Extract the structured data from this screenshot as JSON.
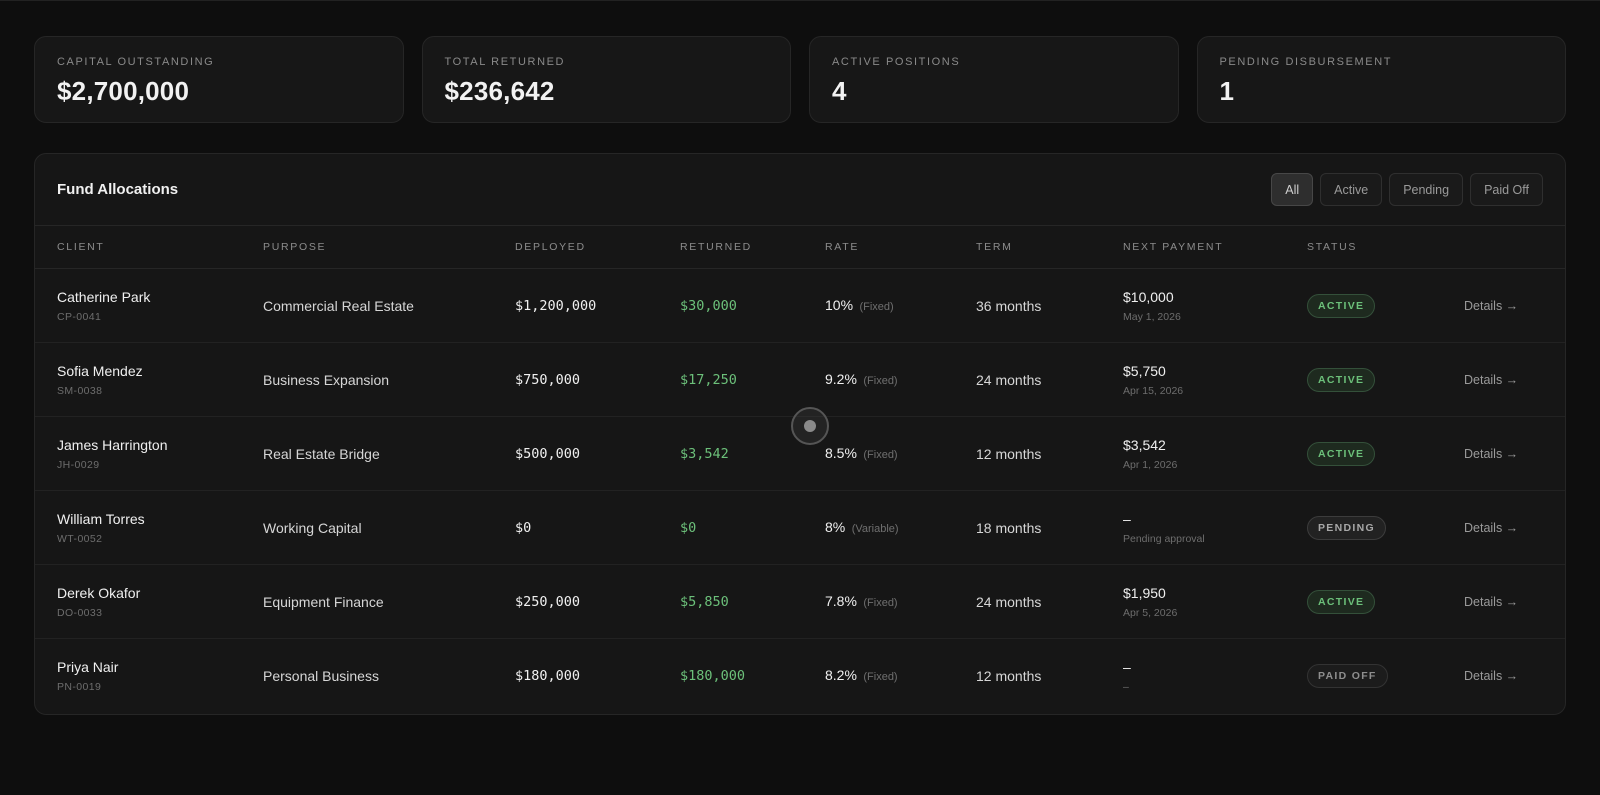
{
  "stats": [
    {
      "label": "Capital Outstanding",
      "value": "$2,700,000"
    },
    {
      "label": "Total Returned",
      "value": "$236,642"
    },
    {
      "label": "Active Positions",
      "value": "4"
    },
    {
      "label": "Pending Disbursement",
      "value": "1"
    }
  ],
  "panel": {
    "title": "Fund Allocations",
    "filters": [
      "All",
      "Active",
      "Pending",
      "Paid Off"
    ],
    "active_filter": "All"
  },
  "table": {
    "headers": [
      "Client",
      "Purpose",
      "Deployed",
      "Returned",
      "Rate",
      "Term",
      "Next Payment",
      "Status"
    ],
    "rows": [
      {
        "name": "Catherine Park",
        "id": "CP-0041",
        "purpose": "Commercial Real Estate",
        "deployed": "$1,200,000",
        "returned": "$30,000",
        "rate": "10%",
        "rate_type": "(Fixed)",
        "term": "36 months",
        "next_amount": "$10,000",
        "next_date": "May 1, 2026",
        "status": "Active",
        "action": "Details →"
      },
      {
        "name": "Sofia Mendez",
        "id": "SM-0038",
        "purpose": "Business Expansion",
        "deployed": "$750,000",
        "returned": "$17,250",
        "rate": "9.2%",
        "rate_type": "(Fixed)",
        "term": "24 months",
        "next_amount": "$5,750",
        "next_date": "Apr 15, 2026",
        "status": "Active",
        "action": "Details →"
      },
      {
        "name": "James Harrington",
        "id": "JH-0029",
        "purpose": "Real Estate Bridge",
        "deployed": "$500,000",
        "returned": "$3,542",
        "rate": "8.5%",
        "rate_type": "(Fixed)",
        "term": "12 months",
        "next_amount": "$3,542",
        "next_date": "Apr 1, 2026",
        "status": "Active",
        "action": "Details →"
      },
      {
        "name": "William Torres",
        "id": "WT-0052",
        "purpose": "Working Capital",
        "deployed": "$0",
        "returned": "$0",
        "rate": "8%",
        "rate_type": "(Variable)",
        "term": "18 months",
        "next_amount": "–",
        "next_date": "Pending approval",
        "status": "Pending",
        "action": "Details →"
      },
      {
        "name": "Derek Okafor",
        "id": "DO-0033",
        "purpose": "Equipment Finance",
        "deployed": "$250,000",
        "returned": "$5,850",
        "rate": "7.8%",
        "rate_type": "(Fixed)",
        "term": "24 months",
        "next_amount": "$1,950",
        "next_date": "Apr 5, 2026",
        "status": "Active",
        "action": "Details →"
      },
      {
        "name": "Priya Nair",
        "id": "PN-0019",
        "purpose": "Personal Business",
        "deployed": "$180,000",
        "returned": "$180,000",
        "rate": "8.2%",
        "rate_type": "(Fixed)",
        "term": "12 months",
        "next_amount": "–",
        "next_date": "–",
        "status": "Paid Off",
        "action": "Details →"
      }
    ]
  },
  "colors": {
    "accent_green": "#6cc07a",
    "background": "#0e0e0e",
    "card": "#171717"
  }
}
